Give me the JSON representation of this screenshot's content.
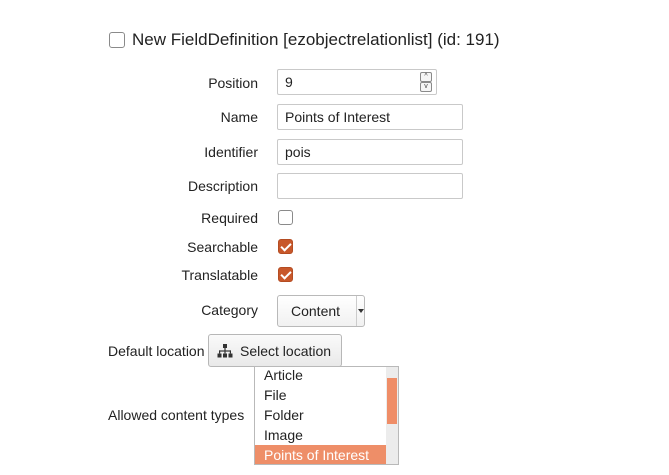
{
  "header": {
    "title": "New FieldDefinition [ezobjectrelationlist] (id: 191)",
    "checkbox_checked": false
  },
  "form": {
    "position": {
      "label": "Position",
      "value": "9",
      "spin_up": "^",
      "spin_down": "v"
    },
    "name": {
      "label": "Name",
      "value": "Points of Interest"
    },
    "identifier": {
      "label": "Identifier",
      "value": "pois"
    },
    "description": {
      "label": "Description",
      "value": ""
    },
    "required": {
      "label": "Required",
      "checked": false
    },
    "searchable": {
      "label": "Searchable",
      "checked": true
    },
    "translatable": {
      "label": "Translatable",
      "checked": true
    },
    "category": {
      "label": "Category",
      "selected": "Content"
    },
    "default_location": {
      "label": "Default location",
      "button_label": "Select location",
      "button_icon": "sitemap-icon"
    },
    "allowed_content_types": {
      "label": "Allowed content types",
      "options": [
        "Article",
        "File",
        "Folder",
        "Image",
        "Points of Interest"
      ],
      "selected": "Points of Interest"
    }
  },
  "colors": {
    "accent": "#c8582b",
    "selection": "#ee8e68"
  }
}
